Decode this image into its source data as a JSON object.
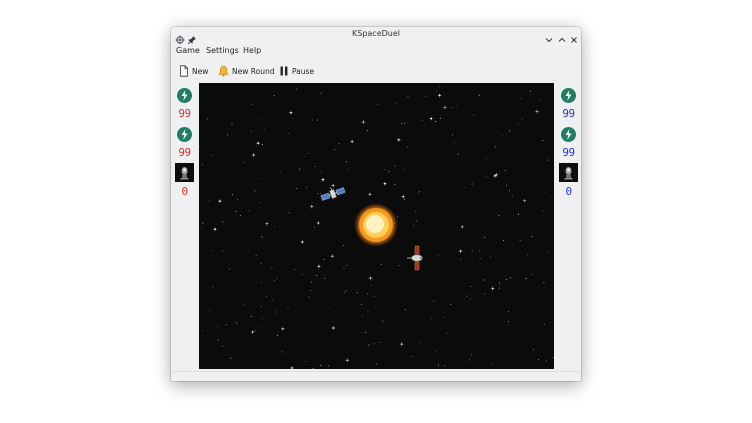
{
  "window": {
    "title": "KSpaceDuel"
  },
  "menu": {
    "items": [
      "Game",
      "Settings",
      "Help"
    ]
  },
  "toolbar": {
    "new_label": "New",
    "new_round_label": "New Round",
    "pause_label": "Pause"
  },
  "player_left": {
    "color": "#e0302a",
    "energy": "99",
    "shields": "99",
    "wins": "0"
  },
  "player_right": {
    "color": "#2a34d6",
    "energy": "99",
    "shields": "99",
    "wins": "0"
  },
  "colors": {
    "space_background": "#0b0b0b",
    "sun_core": "#fff6c8",
    "sun_edge": "#f38a10",
    "indicator_green": "#1f7d61"
  },
  "icons": {
    "window_menu": "kde-window-menu-icon",
    "pin": "pin-icon",
    "minimize": "chevron-down-icon",
    "maximize": "chevron-up-icon",
    "close": "close-icon",
    "new": "document-new-icon",
    "new_round": "bell-icon",
    "pause": "pause-icon",
    "energy": "energy-bolt-icon"
  }
}
